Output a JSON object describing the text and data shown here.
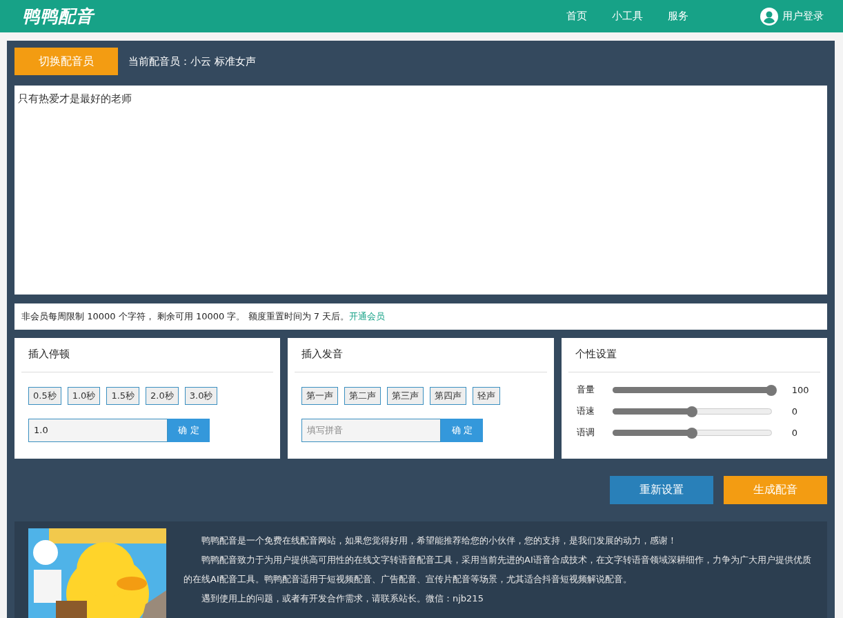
{
  "header": {
    "logo": "鸭鸭配音",
    "nav": [
      {
        "label": "首页"
      },
      {
        "label": "小工具"
      },
      {
        "label": "服务"
      }
    ],
    "login": "用户登录"
  },
  "voice_bar": {
    "switch_button": "切换配音员",
    "current": "当前配音员：小云 标准女声"
  },
  "editor": {
    "value": "只有热爱才是最好的老师"
  },
  "notice": {
    "text": "非会员每周限制 10000 个字符， 剩余可用 10000 字。 额度重置时间为 7 天后。",
    "link": "开通会员"
  },
  "pause_panel": {
    "title": "插入停顿",
    "chips": [
      "0.5秒",
      "1.0秒",
      "1.5秒",
      "2.0秒",
      "3.0秒"
    ],
    "input": {
      "value": "1.0"
    },
    "confirm": "确 定"
  },
  "tone_panel": {
    "title": "插入发音",
    "chips": [
      "第一声",
      "第二声",
      "第三声",
      "第四声",
      "轻声"
    ],
    "input": {
      "placeholder": "填写拼音"
    },
    "confirm": "确 定"
  },
  "settings_panel": {
    "title": "个性设置",
    "sliders": [
      {
        "label": "音量",
        "level": 1.0,
        "reading": "100"
      },
      {
        "label": "语速",
        "level": 0.5,
        "reading": "0"
      },
      {
        "label": "语调",
        "level": 0.5,
        "reading": "0"
      }
    ]
  },
  "actions": [
    {
      "label": "重新设置",
      "kind": "reset"
    },
    {
      "label": "生成配音",
      "kind": "generate"
    }
  ],
  "about": {
    "paragraphs": [
      "鸭鸭配音是一个免费在线配音网站，如果您觉得好用，希望能推荐给您的小伙伴，您的支持，是我们发展的动力，感谢！",
      "鸭鸭配音致力于为用户提供高可用性的在线文字转语音配音工具，采用当前先进的AI语音合成技术，在文字转语音领域深耕细作，力争为广大用户提供优质的在线AI配音工具。鸭鸭配音适用于短视频配音、广告配音、宣传片配音等场景，尤其适合抖音短视频解说配音。",
      "遇到使用上的问题，或者有开发合作需求，请联系站长。微信：njb215"
    ]
  }
}
